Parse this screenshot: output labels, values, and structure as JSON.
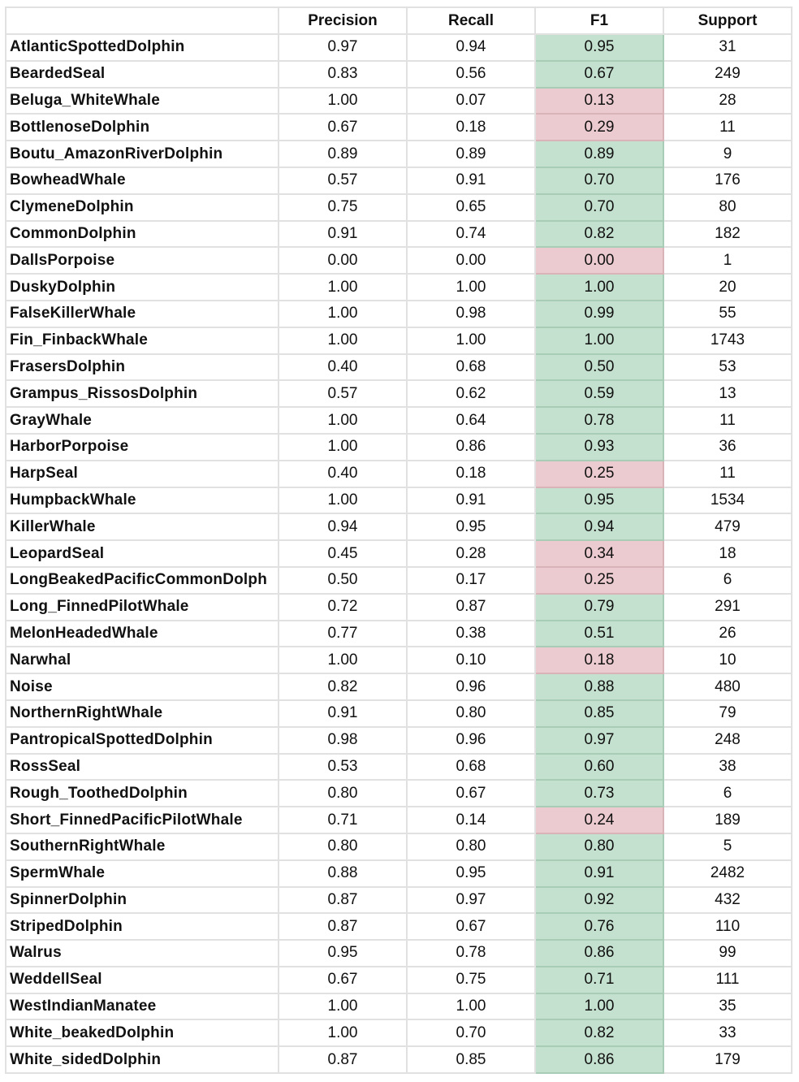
{
  "table": {
    "columns": [
      "",
      "Precision",
      "Recall",
      "F1",
      "Support"
    ],
    "colors": {
      "good_fill": "#c4e0cf",
      "bad_fill": "#ebcbcf",
      "grid": "#e1e1e1"
    },
    "rows": [
      {
        "label": "AtlanticSpottedDolphin",
        "precision": "0.97",
        "recall": "0.94",
        "f1": "0.95",
        "support": "31",
        "status": "good"
      },
      {
        "label": "BeardedSeal",
        "precision": "0.83",
        "recall": "0.56",
        "f1": "0.67",
        "support": "249",
        "status": "good"
      },
      {
        "label": "Beluga_WhiteWhale",
        "precision": "1.00",
        "recall": "0.07",
        "f1": "0.13",
        "support": "28",
        "status": "bad"
      },
      {
        "label": "BottlenoseDolphin",
        "precision": "0.67",
        "recall": "0.18",
        "f1": "0.29",
        "support": "11",
        "status": "bad"
      },
      {
        "label": "Boutu_AmazonRiverDolphin",
        "precision": "0.89",
        "recall": "0.89",
        "f1": "0.89",
        "support": "9",
        "status": "good"
      },
      {
        "label": "BowheadWhale",
        "precision": "0.57",
        "recall": "0.91",
        "f1": "0.70",
        "support": "176",
        "status": "good"
      },
      {
        "label": "ClymeneDolphin",
        "precision": "0.75",
        "recall": "0.65",
        "f1": "0.70",
        "support": "80",
        "status": "good"
      },
      {
        "label": "CommonDolphin",
        "precision": "0.91",
        "recall": "0.74",
        "f1": "0.82",
        "support": "182",
        "status": "good"
      },
      {
        "label": "DallsPorpoise",
        "precision": "0.00",
        "recall": "0.00",
        "f1": "0.00",
        "support": "1",
        "status": "bad"
      },
      {
        "label": "DuskyDolphin",
        "precision": "1.00",
        "recall": "1.00",
        "f1": "1.00",
        "support": "20",
        "status": "good"
      },
      {
        "label": "FalseKillerWhale",
        "precision": "1.00",
        "recall": "0.98",
        "f1": "0.99",
        "support": "55",
        "status": "good"
      },
      {
        "label": "Fin_FinbackWhale",
        "precision": "1.00",
        "recall": "1.00",
        "f1": "1.00",
        "support": "1743",
        "status": "good"
      },
      {
        "label": "FrasersDolphin",
        "precision": "0.40",
        "recall": "0.68",
        "f1": "0.50",
        "support": "53",
        "status": "good"
      },
      {
        "label": "Grampus_RissosDolphin",
        "precision": "0.57",
        "recall": "0.62",
        "f1": "0.59",
        "support": "13",
        "status": "good"
      },
      {
        "label": "GrayWhale",
        "precision": "1.00",
        "recall": "0.64",
        "f1": "0.78",
        "support": "11",
        "status": "good"
      },
      {
        "label": "HarborPorpoise",
        "precision": "1.00",
        "recall": "0.86",
        "f1": "0.93",
        "support": "36",
        "status": "good"
      },
      {
        "label": "HarpSeal",
        "precision": "0.40",
        "recall": "0.18",
        "f1": "0.25",
        "support": "11",
        "status": "bad"
      },
      {
        "label": "HumpbackWhale",
        "precision": "1.00",
        "recall": "0.91",
        "f1": "0.95",
        "support": "1534",
        "status": "good"
      },
      {
        "label": "KillerWhale",
        "precision": "0.94",
        "recall": "0.95",
        "f1": "0.94",
        "support": "479",
        "status": "good"
      },
      {
        "label": "LeopardSeal",
        "precision": "0.45",
        "recall": "0.28",
        "f1": "0.34",
        "support": "18",
        "status": "bad"
      },
      {
        "label": "LongBeakedPacificCommonDolph",
        "precision": "0.50",
        "recall": "0.17",
        "f1": "0.25",
        "support": "6",
        "status": "bad"
      },
      {
        "label": "Long_FinnedPilotWhale",
        "precision": "0.72",
        "recall": "0.87",
        "f1": "0.79",
        "support": "291",
        "status": "good"
      },
      {
        "label": "MelonHeadedWhale",
        "precision": "0.77",
        "recall": "0.38",
        "f1": "0.51",
        "support": "26",
        "status": "good"
      },
      {
        "label": "Narwhal",
        "precision": "1.00",
        "recall": "0.10",
        "f1": "0.18",
        "support": "10",
        "status": "bad"
      },
      {
        "label": "Noise",
        "precision": "0.82",
        "recall": "0.96",
        "f1": "0.88",
        "support": "480",
        "status": "good"
      },
      {
        "label": "NorthernRightWhale",
        "precision": "0.91",
        "recall": "0.80",
        "f1": "0.85",
        "support": "79",
        "status": "good"
      },
      {
        "label": "PantropicalSpottedDolphin",
        "precision": "0.98",
        "recall": "0.96",
        "f1": "0.97",
        "support": "248",
        "status": "good"
      },
      {
        "label": "RossSeal",
        "precision": "0.53",
        "recall": "0.68",
        "f1": "0.60",
        "support": "38",
        "status": "good"
      },
      {
        "label": "Rough_ToothedDolphin",
        "precision": "0.80",
        "recall": "0.67",
        "f1": "0.73",
        "support": "6",
        "status": "good"
      },
      {
        "label": "Short_FinnedPacificPilotWhale",
        "precision": "0.71",
        "recall": "0.14",
        "f1": "0.24",
        "support": "189",
        "status": "bad"
      },
      {
        "label": "SouthernRightWhale",
        "precision": "0.80",
        "recall": "0.80",
        "f1": "0.80",
        "support": "5",
        "status": "good"
      },
      {
        "label": "SpermWhale",
        "precision": "0.88",
        "recall": "0.95",
        "f1": "0.91",
        "support": "2482",
        "status": "good"
      },
      {
        "label": "SpinnerDolphin",
        "precision": "0.87",
        "recall": "0.97",
        "f1": "0.92",
        "support": "432",
        "status": "good"
      },
      {
        "label": "StripedDolphin",
        "precision": "0.87",
        "recall": "0.67",
        "f1": "0.76",
        "support": "110",
        "status": "good"
      },
      {
        "label": "Walrus",
        "precision": "0.95",
        "recall": "0.78",
        "f1": "0.86",
        "support": "99",
        "status": "good"
      },
      {
        "label": "WeddellSeal",
        "precision": "0.67",
        "recall": "0.75",
        "f1": "0.71",
        "support": "111",
        "status": "good"
      },
      {
        "label": "WestIndianManatee",
        "precision": "1.00",
        "recall": "1.00",
        "f1": "1.00",
        "support": "35",
        "status": "good"
      },
      {
        "label": "White_beakedDolphin",
        "precision": "1.00",
        "recall": "0.70",
        "f1": "0.82",
        "support": "33",
        "status": "good"
      },
      {
        "label": "White_sidedDolphin",
        "precision": "0.87",
        "recall": "0.85",
        "f1": "0.86",
        "support": "179",
        "status": "good"
      }
    ]
  }
}
